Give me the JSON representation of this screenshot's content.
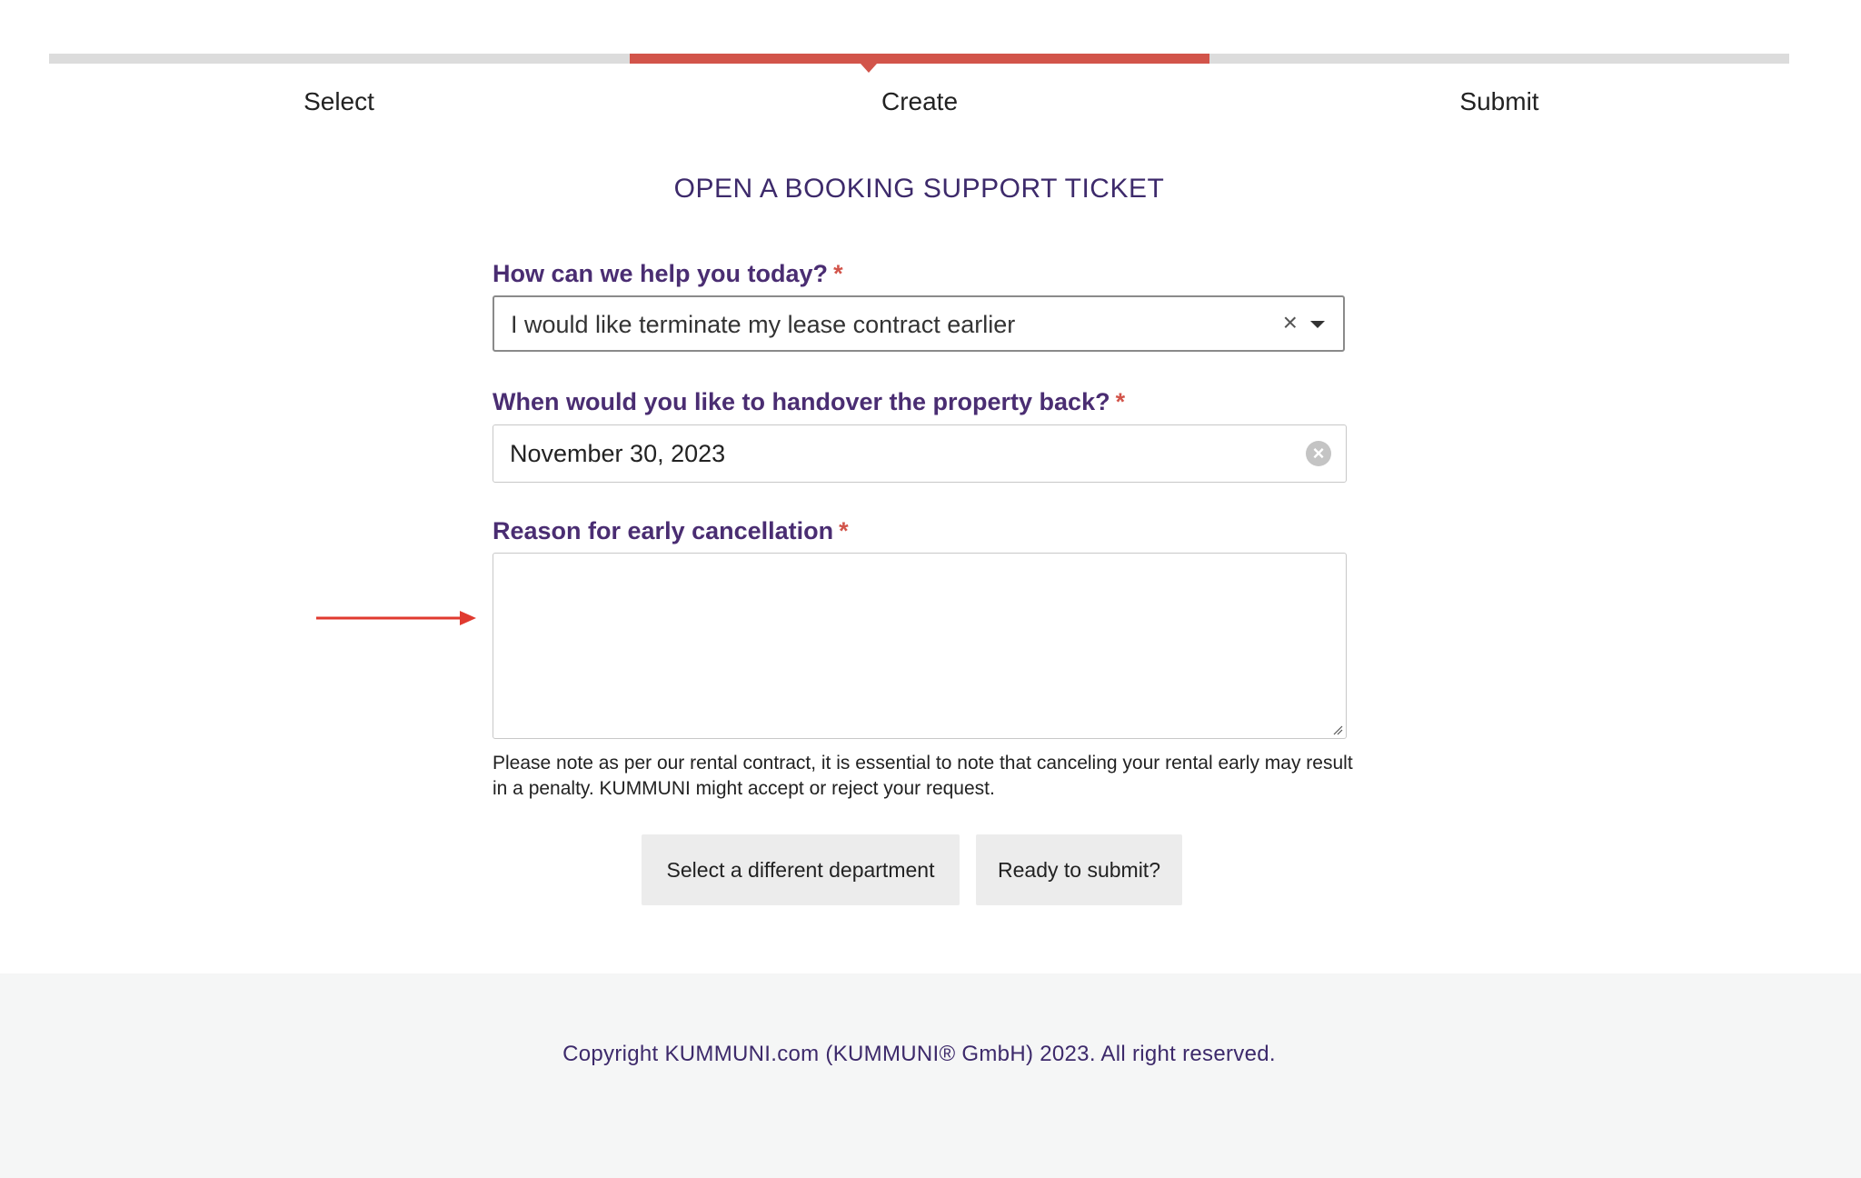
{
  "stepper": {
    "steps": [
      {
        "label": "Select"
      },
      {
        "label": "Create"
      },
      {
        "label": "Submit"
      }
    ],
    "active_step": "Create"
  },
  "form": {
    "title": "OPEN A BOOKING SUPPORT TICKET",
    "required_marker": "*",
    "help_field": {
      "label": "How can we help you today?",
      "value": "I would like terminate my lease contract earlier",
      "clear_glyph": "×"
    },
    "handover_field": {
      "label": "When would you like to handover the property back?",
      "value": "November 30, 2023",
      "clear_glyph": "×"
    },
    "reason_field": {
      "label": "Reason for early cancellation",
      "value": ""
    },
    "note": "Please note as per our rental contract, it is essential to note that canceling your rental early may result in a penalty. KUMMUNI might accept or reject your request."
  },
  "buttons": {
    "different_department": "Select a different department",
    "ready_to_submit": "Ready to submit?"
  },
  "footer": {
    "copyright": "Copyright KUMMUNI.com (KUMMUNI® GmbH) 2023. All right reserved."
  },
  "colors": {
    "accent": "#d2544a",
    "label_purple": "#4a2d72",
    "inactive_track": "#dcdcdc",
    "footer_bg": "#f5f6f6"
  }
}
